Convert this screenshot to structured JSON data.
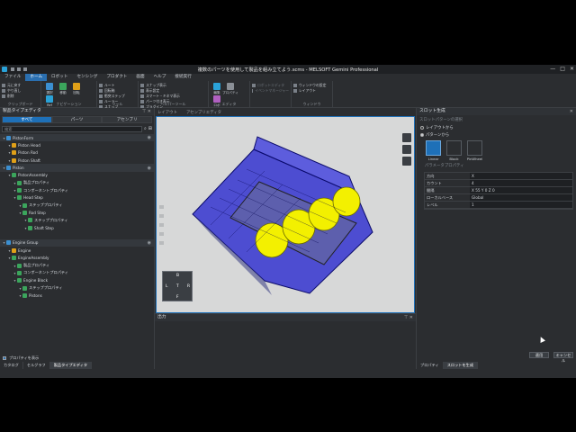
{
  "window": {
    "title": "複数のパーツを使用して製品を組み立てよう.scms - MELSOFT Gemini Professional",
    "controls": [
      "—",
      "□",
      "✕"
    ]
  },
  "menu": [
    "ファイル",
    "ホーム",
    "ロボット",
    "センシング",
    "プロダクト",
    "画面",
    "ヘルプ",
    "接続実行"
  ],
  "menu_active": "ホーム",
  "ribbon": {
    "groups": [
      {
        "label": "クリップボード",
        "rows": [
          "元に戻す",
          "やり直し",
          "削除"
        ]
      },
      {
        "label": "ナビゲーション",
        "buttons": [
          "選択",
          "移動",
          "回転",
          "Ref"
        ]
      },
      {
        "label": "ツール",
        "rows": [
          "ルート",
          "回転軸",
          "衝突ステップ",
          "ルーラー",
          "スナップ"
        ]
      },
      {
        "label": "ヘルパーツール",
        "rows": [
          "スナップ表示",
          "表示設定",
          "スマート・キネマ表示",
          "パーツ付き表示",
          "プラグイン"
        ]
      },
      {
        "label": "エディタ",
        "buttons": [
          "編集",
          "プロパティ",
          "ロボ"
        ]
      },
      {
        "label": "",
        "rows": [
          "ロボットエディタ",
          "イベントマネージャー"
        ]
      },
      {
        "label": "ウィンドウ",
        "rows": [
          "ウィンドウの設定",
          "レイアウト"
        ]
      }
    ]
  },
  "left_panel": {
    "title": "製品タイプエディタ",
    "tabs": [
      "すべて",
      "パーツ",
      "アセンブリ"
    ],
    "search_placeholder": "検索",
    "tree": [
      {
        "label": "PistonForm",
        "lvl": 0,
        "hdr": true,
        "c": "#3b8fd1"
      },
      {
        "label": "Piston Head",
        "lvl": 1,
        "c": "#e0a018"
      },
      {
        "label": "Piston Rod",
        "lvl": 1,
        "c": "#e0a018"
      },
      {
        "label": "Piston Shaft",
        "lvl": 1,
        "c": "#e0a018"
      },
      {
        "label": "Piston",
        "lvl": 0,
        "hdr": true,
        "c": "#3b8fd1"
      },
      {
        "label": "PistonAssembly",
        "lvl": 1,
        "c": "#3ba55c"
      },
      {
        "label": "製品プロパティ",
        "lvl": 2,
        "c": "#3ba55c"
      },
      {
        "label": "コンポーネントプロパティ",
        "lvl": 2,
        "c": "#3ba55c"
      },
      {
        "label": "Head Step",
        "lvl": 2,
        "c": "#3ba55c"
      },
      {
        "label": "ステッププロパティ",
        "lvl": 3,
        "c": "#3ba55c"
      },
      {
        "label": "Rod Step",
        "lvl": 3,
        "c": "#3ba55c"
      },
      {
        "label": "ステッププロパティ",
        "lvl": 4,
        "c": "#3ba55c"
      },
      {
        "label": "Shaft Step",
        "lvl": 4,
        "c": "#3ba55c"
      },
      {
        "label": "",
        "lvl": 0,
        "c": ""
      },
      {
        "label": "Engine Group",
        "lvl": 0,
        "hdr": true,
        "c": "#3b8fd1"
      },
      {
        "label": "Engine",
        "lvl": 1,
        "c": "#e0a018"
      },
      {
        "label": "EngineAssembly",
        "lvl": 1,
        "c": "#3ba55c"
      },
      {
        "label": "製品プロパティ",
        "lvl": 2,
        "c": "#3ba55c"
      },
      {
        "label": "コンポーネントプロパティ",
        "lvl": 2,
        "c": "#3ba55c"
      },
      {
        "label": "Engine Block",
        "lvl": 2,
        "c": "#3ba55c"
      },
      {
        "label": "ステッププロパティ",
        "lvl": 3,
        "c": "#3ba55c"
      },
      {
        "label": "Pistons",
        "lvl": 3,
        "c": "#3ba55c"
      }
    ],
    "footer_check": "プロパティを表示",
    "bottom_tabs": [
      "カタログ",
      "セルグラフ",
      "製品タイプエディタ"
    ]
  },
  "viewport": {
    "tabs": [
      "レイアウト",
      "アセンブリエディタ"
    ],
    "nav_letters": [
      "B",
      "L",
      "T",
      "R",
      "F"
    ]
  },
  "output_panel": {
    "title": "出力"
  },
  "right_panel": {
    "title": "スロット生成",
    "section_select": "スロットパターンの選択",
    "radio1": "レイアウトから",
    "radio2": "パターンから",
    "cubes": [
      "Linear",
      "Block",
      "PinWheel"
    ],
    "params_title": "パラメータプロパティ",
    "params": [
      {
        "k": "方向",
        "v": "X"
      },
      {
        "k": "カウント",
        "v": "4"
      },
      {
        "k": "間隔",
        "v": "X 55  Y 0  Z 0"
      },
      {
        "k": "ローカルベース",
        "v": "Global"
      },
      {
        "k": "レベル",
        "v": "1"
      }
    ],
    "ok": "適用",
    "cancel": "キャンセル",
    "bottom_tabs": [
      "プロパティ",
      "スロットを生成"
    ]
  }
}
